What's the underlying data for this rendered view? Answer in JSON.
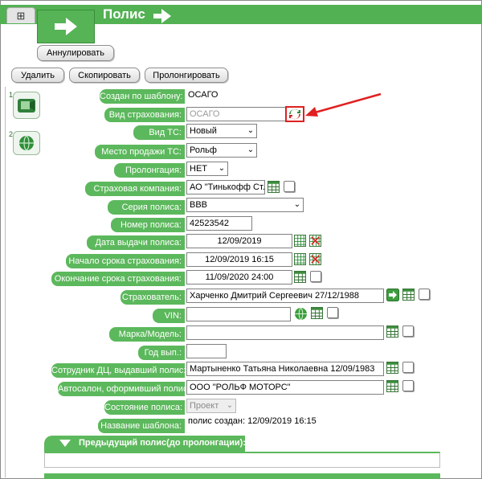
{
  "header": {
    "title": "Полис",
    "home_tab_icon": "grid-icon",
    "colors": {
      "accent": "#52b152",
      "label_bg": "#5cb85c",
      "annotation": "#e02020"
    }
  },
  "toolbar": {
    "annul_label": "Аннулировать",
    "delete_label": "Удалить",
    "copy_label": "Скопировать",
    "prolong_label": "Пролонгировать"
  },
  "side": {
    "num1": "1",
    "num2": "2"
  },
  "form": {
    "template_label": "Создан по шаблону:",
    "template_value": "ОСАГО",
    "insurance_type_label": "Вид страхования:",
    "insurance_type_value": "ОСАГО",
    "vehicle_type_label": "Вид ТС:",
    "vehicle_type_value": "Новый",
    "sale_place_label": "Место продажи ТС:",
    "sale_place_value": "Рольф",
    "prolongation_label": "Пролонгация:",
    "prolongation_value": "НЕТ",
    "company_label": "Страховая компания:",
    "company_value": "АО \"Тинькофф Ст...",
    "series_label": "Серия полиса:",
    "series_value": "ВВВ",
    "number_label": "Номер полиса:",
    "number_value": "42523542",
    "issue_date_label": "Дата выдачи полиса:",
    "issue_date_value": "12/09/2019",
    "start_label": "Начало срока страхования:",
    "start_value": "12/09/2019 16:15",
    "end_label": "Окончание срока страхования:",
    "end_value": "11/09/2020 24:00",
    "insurer_label": "Страхователь:",
    "insurer_value": "Харченко Дмитрий Сергеевич 27/12/1988",
    "vin_label": "VIN:",
    "vin_value": "",
    "brand_label": "Марка/Модель:",
    "brand_value": "",
    "year_label": "Год вып.:",
    "year_value": "",
    "employee_label": "Сотрудник ДЦ, выдавший полис:",
    "employee_value": "Мартыненко Татьяна Николаевна 12/09/1983",
    "dealer_label": "Автосалон, оформивший полис:",
    "dealer_value": "ООО \"РОЛЬФ МОТОРС\"",
    "state_label": "Состояние полиса:",
    "state_value": "Проект",
    "template_name_label": "Название шаблона:",
    "template_name_value": "полис создан: 12/09/2019 16:15"
  },
  "section": {
    "previous_policy_label": "Предыдущий полис(до пролонгации):"
  }
}
